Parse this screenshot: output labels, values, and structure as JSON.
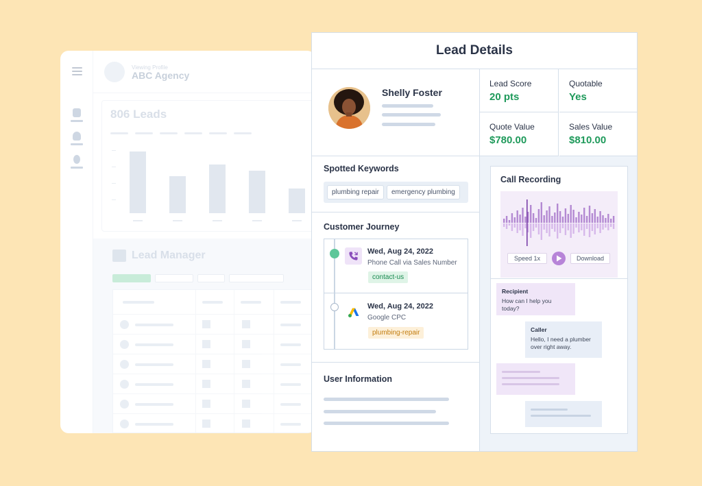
{
  "background_app": {
    "viewing_label": "Viewing Profile",
    "agency_name": "ABC Agency",
    "leads_title": "806 Leads",
    "lead_manager_title": "Lead Manager"
  },
  "lead_details": {
    "title": "Lead Details",
    "profile": {
      "name": "Shelly Foster"
    },
    "stats": [
      {
        "label": "Lead Score",
        "value": "20 pts"
      },
      {
        "label": "Quotable",
        "value": "Yes"
      },
      {
        "label": "Quote Value",
        "value": "$780.00"
      },
      {
        "label": "Sales Value",
        "value": "$810.00"
      }
    ],
    "spotted_keywords": {
      "title": "Spotted Keywords",
      "items": [
        "plumbing repair",
        "emergency plumbing"
      ]
    },
    "customer_journey": {
      "title": "Customer Journey",
      "events": [
        {
          "date": "Wed, Aug 24, 2022",
          "description": "Phone Call via Sales Number",
          "tag": "contact-us",
          "icon": "phone-call-icon"
        },
        {
          "date": "Wed, Aug 24, 2022",
          "description": "Google CPC",
          "tag": "plumbing-repair",
          "icon": "google-ads-icon"
        }
      ]
    },
    "user_information": {
      "title": "User Information"
    },
    "call_recording": {
      "title": "Call Recording",
      "speed_label": "Speed 1x",
      "download_label": "Download",
      "messages": [
        {
          "speaker": "Recipient",
          "text": "How can I help you today?"
        },
        {
          "speaker": "Caller",
          "text": "Hello, I need a plumber over right away."
        }
      ]
    }
  },
  "colors": {
    "background": "#fde5b5",
    "value_green": "#1f9a5b",
    "accent_purple": "#b784d8"
  }
}
